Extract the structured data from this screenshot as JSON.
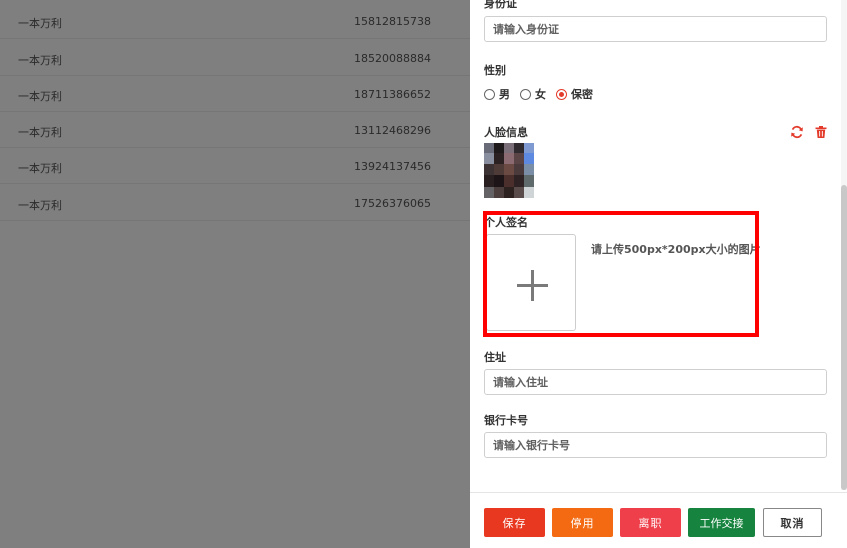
{
  "table": {
    "rows": [
      {
        "name": "一本万利",
        "phone": "15812815738"
      },
      {
        "name": "一本万利",
        "phone": "18520088884"
      },
      {
        "name": "一本万利",
        "phone": "18711386652"
      },
      {
        "name": "一本万利",
        "phone": "13112468296"
      },
      {
        "name": "一本万利",
        "phone": "13924137456"
      },
      {
        "name": "一本万利",
        "phone": "17526376065"
      }
    ]
  },
  "form": {
    "id_card": {
      "label": "身份证",
      "placeholder": "请输入身份证"
    },
    "gender": {
      "label": "性别",
      "options": [
        "男",
        "女",
        "保密"
      ],
      "selected": "保密"
    },
    "face": {
      "label": "人脸信息"
    },
    "signature": {
      "label": "个人签名",
      "hint": "请上传500px*200px大小的图片"
    },
    "address": {
      "label": "住址",
      "placeholder": "请输入住址"
    },
    "bank_card": {
      "label": "银行卡号",
      "placeholder": "请输入银行卡号"
    }
  },
  "footer": {
    "save": "保存",
    "disable": "停用",
    "resign": "离职",
    "handover": "工作交接",
    "cancel": "取消"
  },
  "colors": {
    "accent": "#e33b2b",
    "save": "#e8381f",
    "disable": "#f36a12",
    "resign": "#ef3f4a",
    "handover": "#16833e",
    "highlight": "#ff0000"
  },
  "icons": {
    "refresh": "refresh-icon",
    "delete": "trash-icon",
    "upload": "plus-icon"
  }
}
